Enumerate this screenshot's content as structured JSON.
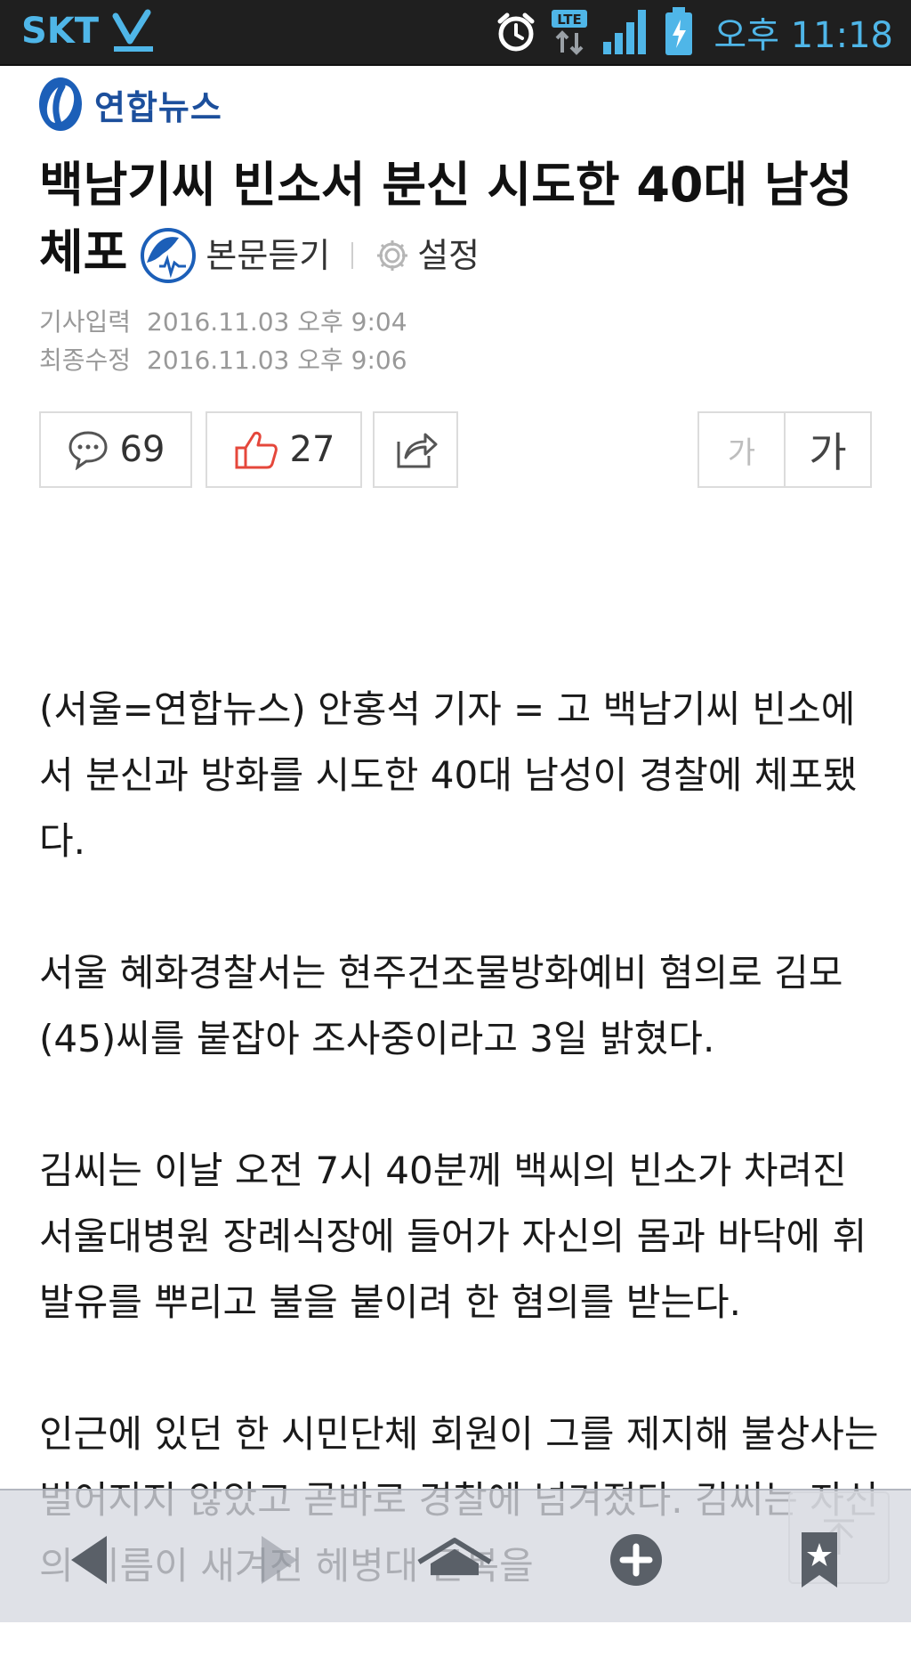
{
  "status_bar": {
    "carrier": "SKT",
    "network": "LTE",
    "time": "오후 11:18",
    "accent_color": "#4fb6e8"
  },
  "header": {
    "logo_text": "연합뉴스",
    "title": "백남기씨 빈소서 분신 시도한 40대 남성 체포",
    "listen_label": "본문듣기",
    "settings_label": "설정"
  },
  "meta": {
    "input_label": "기사입력",
    "input_time": "2016.11.03 오후 9:04",
    "edit_label": "최종수정",
    "edit_time": "2016.11.03 오후 9:06"
  },
  "actions": {
    "comment_count": "69",
    "like_count": "27",
    "font_small_label": "가",
    "font_large_label": "가"
  },
  "article": {
    "paragraphs": [
      "(서울=연합뉴스) 안홍석 기자 = 고 백남기씨 빈소에서 분신과 방화를 시도한 40대 남성이 경찰에 체포됐다.",
      "서울 혜화경찰서는 현주건조물방화예비 혐의로 김모(45)씨를 붙잡아 조사중이라고 3일 밝혔다.",
      "김씨는 이날 오전 7시 40분께 백씨의 빈소가 차려진 서울대병원 장례식장에 들어가 자신의 몸과 바닥에 휘발유를 뿌리고 불을 붙이려 한 혐의를 받는다.",
      "인근에 있던 한 시민단체 회원이 그를 제지해 불상사는 벌어지지 않았고 곧바로 경찰에 넘겨졌다. 김씨는 자신의 이름이 새겨진 헤병대 군복을"
    ]
  },
  "navbar": {
    "icons": [
      "back-icon",
      "forward-icon",
      "home-icon",
      "new-tab-icon",
      "bookmark-icon"
    ]
  }
}
